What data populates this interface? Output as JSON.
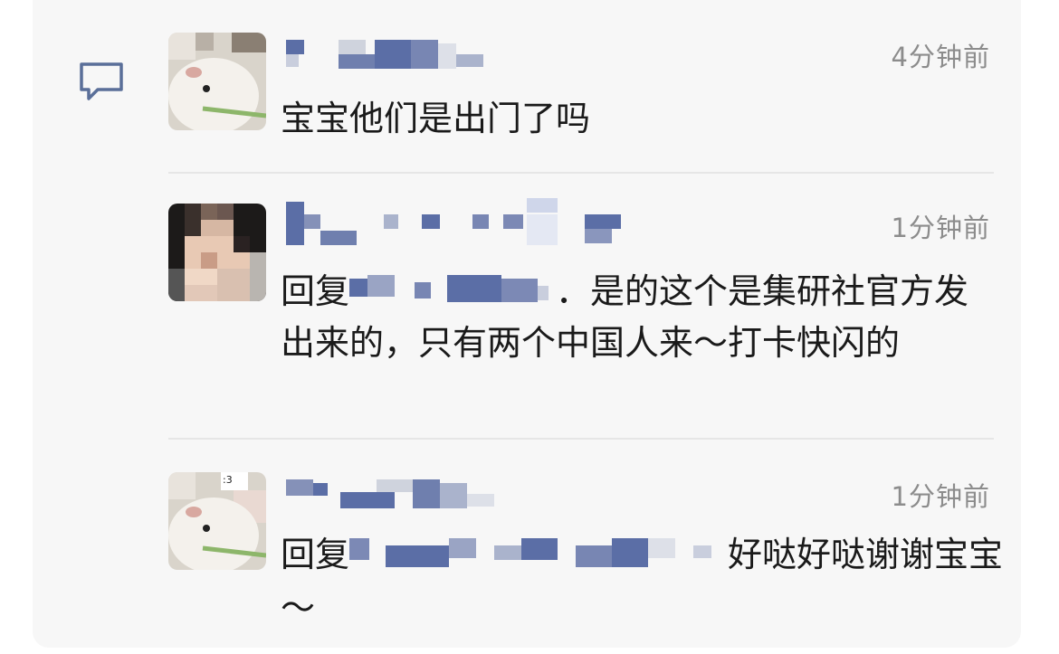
{
  "comments": [
    {
      "time": "4分钟前",
      "text": "宝宝他们是出门了吗"
    },
    {
      "time": "1分钟前",
      "text_prefix": "回复",
      "text_suffix": "．是的这个是集研社官方发出来的，只有两个中国人来～打卡快闪的"
    },
    {
      "time": "1分钟前",
      "text_prefix": "回复",
      "text_suffix": "好哒好哒谢谢宝宝～"
    }
  ],
  "icons": {
    "comment": "comment-bubble-icon"
  },
  "colors": {
    "panel_bg": "#f7f7f7",
    "icon": "#5a6f99",
    "mosaic_blue": "#5b6ea6",
    "time": "#8c8c8c"
  }
}
